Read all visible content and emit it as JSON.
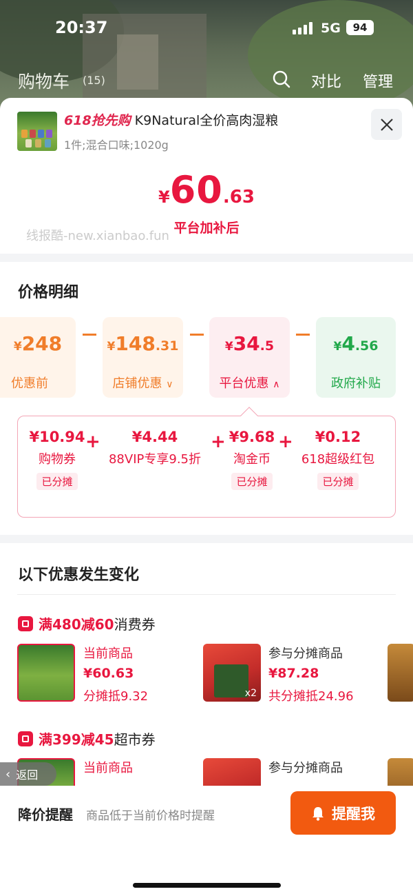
{
  "status": {
    "time": "20:37",
    "network": "5G",
    "battery": "94"
  },
  "cart": {
    "title": "购物车",
    "count": "(15)",
    "compare": "对比",
    "manage": "管理"
  },
  "product": {
    "promo": "618抢先购",
    "name": "K9Natural全价高肉湿粮",
    "spec": "1件;混合口味;1020g",
    "price_symbol": "¥",
    "price_int": "60",
    "price_dec": ".63",
    "price_note": "平台加补后",
    "watermark": "线报酷-new.xianbao.fun"
  },
  "breakdown": {
    "title": "价格明细",
    "items": [
      {
        "symbol": "¥",
        "int": "248",
        "dec": "",
        "label": "优惠前",
        "color": "#f07d2a"
      },
      {
        "symbol": "¥",
        "int": "148",
        "dec": ".31",
        "label": "店铺优惠",
        "color": "#f07d2a"
      },
      {
        "symbol": "¥",
        "int": "34",
        "dec": ".5",
        "label": "平台优惠",
        "color": "#e8173f"
      },
      {
        "symbol": "¥",
        "int": "4",
        "dec": ".56",
        "label": "政府补贴",
        "color": "#21a84a"
      }
    ],
    "details": [
      {
        "amount": "¥10.94",
        "name": "购物券",
        "tag": "已分摊"
      },
      {
        "amount": "¥4.44",
        "name": "88VIP专享9.5折",
        "tag": ""
      },
      {
        "amount": "¥9.68",
        "name": "淘金币",
        "tag": "已分摊"
      },
      {
        "amount": "¥0.12",
        "name": "618超级红包",
        "tag": "已分摊"
      }
    ]
  },
  "changes": {
    "title": "以下优惠发生变化",
    "coupons": [
      {
        "highlight": "满480减60",
        "rest": "消费券",
        "current_label": "当前商品",
        "current_price": "¥60.63",
        "current_note": "分摊抵9.32",
        "share_label": "参与分摊商品",
        "share_price": "¥87.28",
        "share_note": "共分摊抵24.96",
        "qty": "x2"
      },
      {
        "highlight": "满399减45",
        "rest": "超市券",
        "current_label": "当前商品",
        "share_label": "参与分摊商品"
      }
    ]
  },
  "back_label": "返回",
  "footer": {
    "title": "降价提醒",
    "desc": "商品低于当前价格时提醒",
    "button": "提醒我"
  }
}
